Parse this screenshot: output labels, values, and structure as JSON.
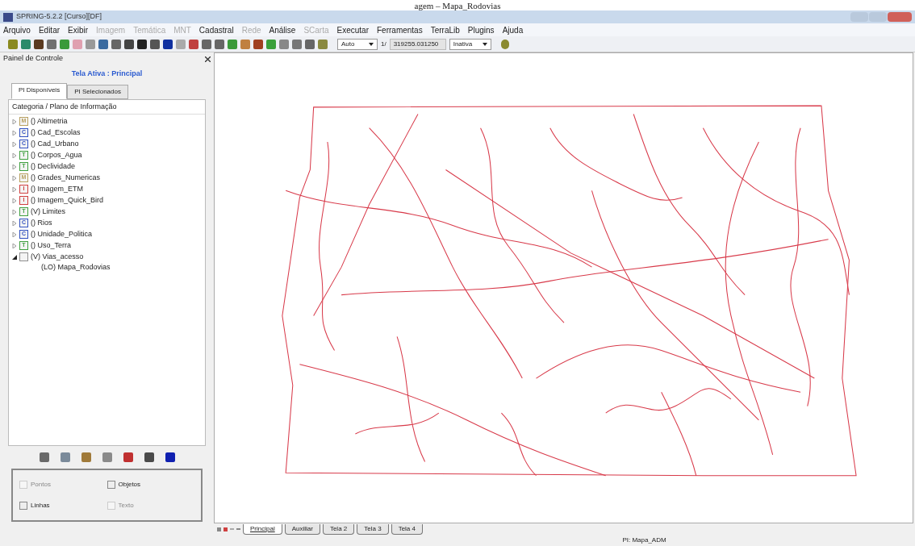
{
  "caption": "agem – Mapa_Rodovias",
  "window": {
    "title": "SPRING-5.2.2 [Curso][DF]"
  },
  "menu": [
    {
      "label": "Arquivo",
      "disabled": false
    },
    {
      "label": "Editar",
      "disabled": false
    },
    {
      "label": "Exibir",
      "disabled": false
    },
    {
      "label": "Imagem",
      "disabled": true
    },
    {
      "label": "Temática",
      "disabled": true
    },
    {
      "label": "MNT",
      "disabled": true
    },
    {
      "label": "Cadastral",
      "disabled": false
    },
    {
      "label": "Rede",
      "disabled": true
    },
    {
      "label": "Análise",
      "disabled": false
    },
    {
      "label": "SCarta",
      "disabled": true
    },
    {
      "label": "Executar",
      "disabled": false
    },
    {
      "label": "Ferramentas",
      "disabled": false
    },
    {
      "label": "TerraLib",
      "disabled": false
    },
    {
      "label": "Plugins",
      "disabled": false
    },
    {
      "label": "Ajuda",
      "disabled": false
    }
  ],
  "toolbar": {
    "scale_mode": "Auto",
    "scale_prefix": "1/",
    "scale_value": "319255.031250",
    "cursor_mode": "Inativa"
  },
  "panel": {
    "title": "Painel de Controle",
    "active_screen": "Tela Ativa : Principal",
    "tabs": [
      {
        "label": "PI Disponíveis",
        "selected": true
      },
      {
        "label": "PI Selecionados",
        "selected": false
      }
    ],
    "tree_header": "Categoria / Plano de Informação",
    "tree": [
      {
        "icon_letter": "M",
        "color": "#b8a060",
        "label": "() Altimetria",
        "expanded": false
      },
      {
        "icon_letter": "C",
        "color": "#3050c0",
        "label": "() Cad_Escolas",
        "expanded": false
      },
      {
        "icon_letter": "C",
        "color": "#3050c0",
        "label": "() Cad_Urbano",
        "expanded": false
      },
      {
        "icon_letter": "T",
        "color": "#40a040",
        "label": "() Corpos_Agua",
        "expanded": false
      },
      {
        "icon_letter": "T",
        "color": "#40a040",
        "label": "() Declividade",
        "expanded": false
      },
      {
        "icon_letter": "M",
        "color": "#b8a060",
        "label": "() Grades_Numericas",
        "expanded": false
      },
      {
        "icon_letter": "I",
        "color": "#d04040",
        "label": "() Imagem_ETM",
        "expanded": false
      },
      {
        "icon_letter": "I",
        "color": "#d04040",
        "label": "() Imagem_Quick_Bird",
        "expanded": false
      },
      {
        "icon_letter": "T",
        "color": "#40a040",
        "label": "(V) Limites",
        "expanded": false
      },
      {
        "icon_letter": "C",
        "color": "#3050c0",
        "label": "() Rios",
        "expanded": false
      },
      {
        "icon_letter": "C",
        "color": "#3050c0",
        "label": "() Unidade_Politica",
        "expanded": false
      },
      {
        "icon_letter": "T",
        "color": "#40a040",
        "label": "() Uso_Terra",
        "expanded": false
      },
      {
        "color": "#909090",
        "label": "(V) Vias_acesso",
        "expanded": true,
        "children": [
          {
            "label": "(LO) Mapa_Rodovias"
          }
        ]
      }
    ],
    "options": [
      {
        "label": "Pontos",
        "checked": false,
        "disabled": true
      },
      {
        "label": "Objetos",
        "checked": false,
        "disabled": false
      },
      {
        "label": "Linhas",
        "checked": false,
        "disabled": false
      },
      {
        "label": "Texto",
        "checked": false,
        "disabled": true
      }
    ]
  },
  "screen_tabs": [
    {
      "label": "Principal",
      "selected": true
    },
    {
      "label": "Auxiliar",
      "selected": false
    },
    {
      "label": "Tela 2",
      "selected": false
    },
    {
      "label": "Tela 3",
      "selected": false
    },
    {
      "label": "Tela 4",
      "selected": false
    }
  ],
  "status_bar": "PI: Mapa_ADM"
}
